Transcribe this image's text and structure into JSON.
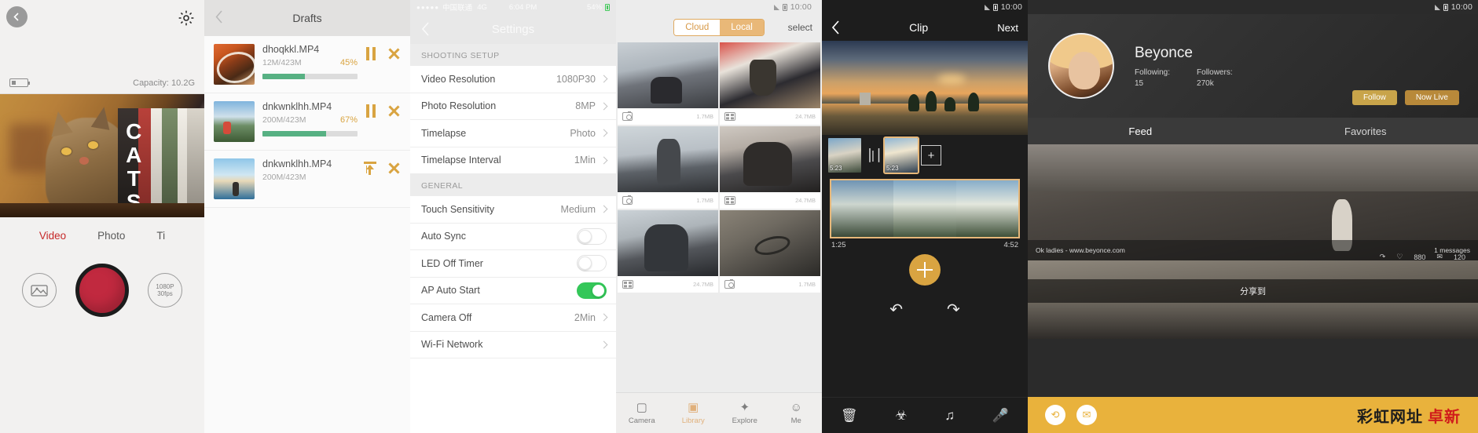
{
  "panels": {
    "camera": {
      "back_icon": "back-arrow-icon",
      "gear_icon": "gear-icon",
      "battery_icon": "battery-icon",
      "capacity_label": "Capacity: 10.2G",
      "modes": [
        {
          "label": "Video",
          "active": true
        },
        {
          "label": "Photo",
          "active": false
        },
        {
          "label": "Ti",
          "active": false
        }
      ],
      "gallery_button": "gallery-icon",
      "shutter_button": "record-button",
      "quality_line1": "1080P",
      "quality_line2": "30fps",
      "photo_overlay_text": "CATS"
    },
    "drafts": {
      "title": "Drafts",
      "back_icon": "chevron-left-icon",
      "items": [
        {
          "name": "dhoqkkl.MP4",
          "size": "12M/423M",
          "percent": "45%",
          "progress": 45,
          "actions": [
            "pause-icon",
            "cancel-icon"
          ]
        },
        {
          "name": "dnkwnklhh.MP4",
          "size": "200M/423M",
          "percent": "67%",
          "progress": 67,
          "actions": [
            "pause-icon",
            "cancel-icon"
          ]
        },
        {
          "name": "dnkwnklhh.MP4",
          "size": "200M/423M",
          "percent": "",
          "progress": 0,
          "actions": [
            "upload-icon",
            "cancel-icon"
          ]
        }
      ]
    },
    "settings": {
      "status_carrier": "中国联通",
      "status_network": "4G",
      "status_time": "6:04 PM",
      "status_battery": "54%",
      "title": "Settings",
      "back_icon": "chevron-left-icon",
      "sections": [
        {
          "header": "SHOOTING SETUP",
          "rows": [
            {
              "label": "Video Resolution",
              "value": "1080P30",
              "type": "value"
            },
            {
              "label": "Photo Resolution",
              "value": "8MP",
              "type": "value"
            },
            {
              "label": "Timelapse",
              "value": "Photo",
              "type": "value"
            },
            {
              "label": "Timelapse Interval",
              "value": "1Min",
              "type": "value"
            }
          ]
        },
        {
          "header": "GENERAL",
          "rows": [
            {
              "label": "Touch Sensitivity",
              "value": "Medium",
              "type": "value"
            },
            {
              "label": "Auto Sync",
              "value": "",
              "type": "toggle",
              "on": false
            },
            {
              "label": "LED Off Timer",
              "value": "",
              "type": "toggle",
              "on": false
            },
            {
              "label": "AP Auto Start",
              "value": "",
              "type": "toggle",
              "on": true
            },
            {
              "label": "Camera Off",
              "value": "2Min",
              "type": "value"
            },
            {
              "label": "Wi-Fi Network",
              "value": "",
              "type": "value"
            }
          ]
        }
      ]
    },
    "gallery": {
      "status_time": "10:00",
      "segments": [
        {
          "label": "Cloud",
          "active": false
        },
        {
          "label": "Local",
          "active": true
        }
      ],
      "select_label": "select",
      "cells": [
        {
          "icon": "camera-icon",
          "size": "1.7MB"
        },
        {
          "icon": "film-icon",
          "size": "24.7MB"
        },
        {
          "icon": "camera-icon",
          "size": "1.7MB"
        },
        {
          "icon": "film-icon",
          "size": "24.7MB"
        },
        {
          "icon": "film-icon",
          "size": "24.7MB"
        },
        {
          "icon": "camera-icon",
          "size": "1.7MB"
        }
      ],
      "tabs": [
        {
          "label": "Camera",
          "icon": "camera-icon",
          "active": false
        },
        {
          "label": "Library",
          "icon": "library-icon",
          "active": true
        },
        {
          "label": "Explore",
          "icon": "compass-icon",
          "active": false
        },
        {
          "label": "Me",
          "icon": "person-icon",
          "active": false
        }
      ]
    },
    "clip": {
      "status_time": "10:00",
      "back_icon": "chevron-left-icon",
      "title": "Clip",
      "next_label": "Next",
      "filmstrip": [
        {
          "time": "5:23",
          "selected": false
        },
        {
          "time": "5:23",
          "selected": true
        }
      ],
      "add_label": "+",
      "split_icon": "split-icon",
      "trim_start": "1:25",
      "trim_end": "4:52",
      "center_icon": "crosshair-icon",
      "undo_icon": "undo-icon",
      "redo_icon": "redo-icon",
      "tools": [
        {
          "icon": "trash-icon",
          "name": "delete-tool"
        },
        {
          "icon": "filter-icon",
          "name": "filter-tool"
        },
        {
          "icon": "music-icon",
          "name": "music-tool"
        },
        {
          "icon": "mic-icon",
          "name": "voice-tool"
        }
      ]
    },
    "social": {
      "status_time": "10:00",
      "username": "Beyonce",
      "following_label": "Following:",
      "following_count": "15",
      "followers_label": "Followers:",
      "followers_count": "270k",
      "follow_button": "Follow",
      "live_button": "Now Live",
      "tabs": [
        {
          "label": "Feed",
          "active": true
        },
        {
          "label": "Favorites",
          "active": false
        }
      ],
      "feed_caption": "Ok ladies - www.beyonce.com",
      "feed_messages": "1 messages",
      "feed_likes": "880",
      "feed_comments": "120",
      "share_label": "分享到",
      "watermark_cn": "彩虹网址",
      "watermark_cl": "卓新",
      "refresh_icon": "refresh-icon",
      "chat_icon": "chat-icon"
    }
  }
}
